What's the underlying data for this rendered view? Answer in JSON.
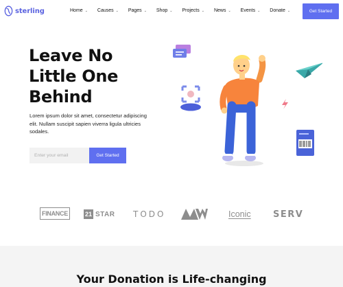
{
  "brand": {
    "name": "sterling",
    "accent": "#5f6ff0",
    "logo_color": "#5b63e0"
  },
  "nav": {
    "items": [
      {
        "label": "Home",
        "caret": "⌄"
      },
      {
        "label": "Causes",
        "caret": "⌄"
      },
      {
        "label": "Pages",
        "caret": "⌄"
      },
      {
        "label": "Shop",
        "caret": "⌄"
      },
      {
        "label": "Projects",
        "caret": "⌄"
      },
      {
        "label": "News",
        "caret": "⌄"
      },
      {
        "label": "Events",
        "caret": "⌄"
      },
      {
        "label": "Donate",
        "caret": "⌄"
      }
    ],
    "cta_label": "Get Started"
  },
  "hero": {
    "title_line1": "Leave No",
    "title_line2": "Little One",
    "title_line3": "Behind",
    "description": "Lorem ipsum dolor sit amet, consectetur adipiscing elit. Nullam suscipit sapien viverra ligula ultricies sodales.",
    "email_placeholder": "Enter your email",
    "cta_label": "Get Started"
  },
  "brands": {
    "finance": "FINANCE",
    "star_box": "21",
    "star_text": "STAR",
    "todo": "TODO",
    "mw": "MW",
    "iconic": "Iconic",
    "serv": "SERV"
  },
  "donation": {
    "title": "Your Donation is Life-changing"
  },
  "icons": {
    "logo": "sterling-logo-icon",
    "character": "waving-person-illustration",
    "chat": "chat-bubbles-icon",
    "paper_plane": "paper-plane-icon",
    "document": "barcode-document-icon",
    "focus": "focus-frame-icon"
  }
}
